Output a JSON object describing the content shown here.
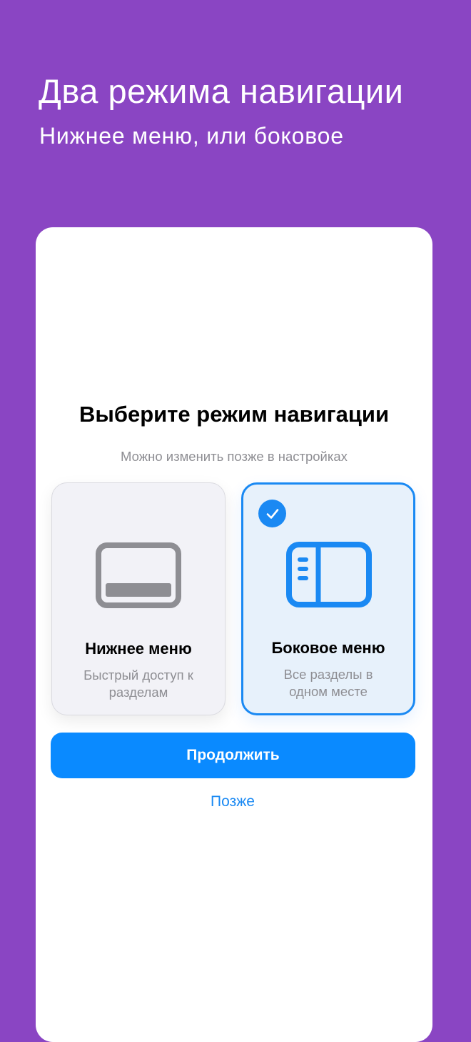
{
  "hero": {
    "title": "Два режима навигации",
    "subtitle": "Нижнее меню, или боковое"
  },
  "sheet": {
    "title": "Выберите режим навигации",
    "subtitle": "Можно изменить позже в настройках"
  },
  "options": [
    {
      "label": "Нижнее меню",
      "description": "Быстрый доступ к разделам",
      "icon": "bottom-menu-icon",
      "selected": false
    },
    {
      "label": "Боковое меню",
      "description": "Все разделы в одном месте",
      "icon": "side-menu-icon",
      "selected": true
    }
  ],
  "actions": {
    "continue_label": "Продолжить",
    "later_label": "Позже"
  },
  "colors": {
    "background": "#8A45C3",
    "accent": "#0A8AFF",
    "selected_card": "#E7F1FB",
    "unselected_card": "#F2F2F7",
    "secondary_text": "#8E8E93"
  }
}
